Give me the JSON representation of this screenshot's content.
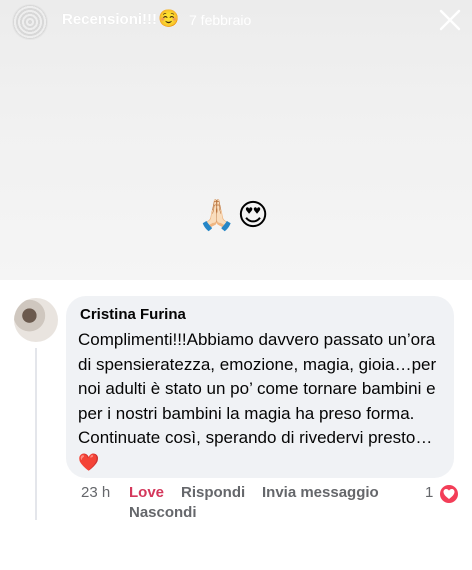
{
  "story": {
    "title": "Recensioni!!!",
    "title_emoji": "☺️",
    "date": "7 febbraio",
    "icons": {
      "close": "close-icon",
      "avatar": "story-avatar"
    },
    "emojis": "🙏🏻😍"
  },
  "comment": {
    "author": "Cristina Furina",
    "text": "Complimenti!!!Abbiamo davvero passato un’ora di spensieratezza, emozione, magia, gioia…per noi adulti è stato un po’ come tornare bambini e per i nostri bambini la magia ha preso forma. Continuate così, sperando di rivedervi presto… ❤️",
    "time": "23 h",
    "actions": {
      "love": "Love",
      "reply": "Rispondi",
      "message": "Invia messaggio",
      "hide": "Nascondi"
    },
    "reaction_count": "1",
    "reaction_icon": "heart-reaction-icon"
  },
  "colors": {
    "bubble": "#f0f2f5",
    "love": "#d4375b",
    "meta": "#65676b",
    "heart": "#f33e58"
  }
}
